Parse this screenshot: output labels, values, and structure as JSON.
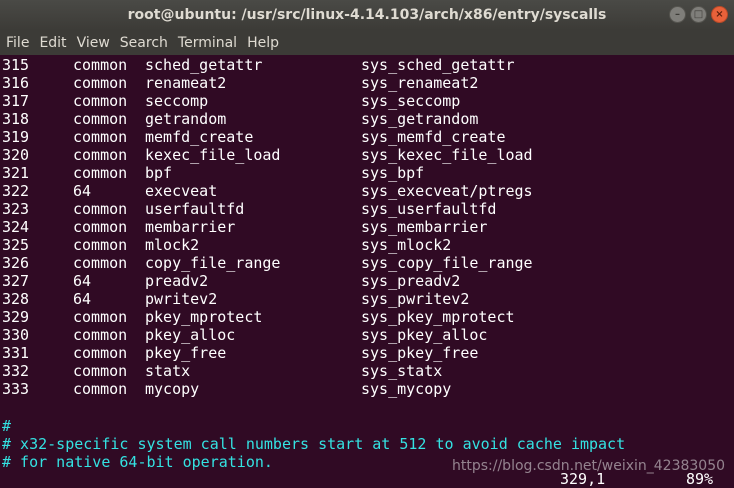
{
  "window": {
    "title": "root@ubuntu: /usr/src/linux-4.14.103/arch/x86/entry/syscalls",
    "minimize": "–",
    "maximize": "□",
    "close": "×"
  },
  "menu": [
    "File",
    "Edit",
    "View",
    "Search",
    "Terminal",
    "Help"
  ],
  "rows": [
    {
      "num": "315",
      "abi": "common",
      "name": "sched_getattr",
      "entry": "sys_sched_getattr"
    },
    {
      "num": "316",
      "abi": "common",
      "name": "renameat2",
      "entry": "sys_renameat2"
    },
    {
      "num": "317",
      "abi": "common",
      "name": "seccomp",
      "entry": "sys_seccomp"
    },
    {
      "num": "318",
      "abi": "common",
      "name": "getrandom",
      "entry": "sys_getrandom"
    },
    {
      "num": "319",
      "abi": "common",
      "name": "memfd_create",
      "entry": "sys_memfd_create"
    },
    {
      "num": "320",
      "abi": "common",
      "name": "kexec_file_load",
      "entry": "sys_kexec_file_load"
    },
    {
      "num": "321",
      "abi": "common",
      "name": "bpf",
      "entry": "sys_bpf"
    },
    {
      "num": "322",
      "abi": "64",
      "name": "execveat",
      "entry": "sys_execveat/ptregs"
    },
    {
      "num": "323",
      "abi": "common",
      "name": "userfaultfd",
      "entry": "sys_userfaultfd"
    },
    {
      "num": "324",
      "abi": "common",
      "name": "membarrier",
      "entry": "sys_membarrier"
    },
    {
      "num": "325",
      "abi": "common",
      "name": "mlock2",
      "entry": "sys_mlock2"
    },
    {
      "num": "326",
      "abi": "common",
      "name": "copy_file_range",
      "entry": "sys_copy_file_range"
    },
    {
      "num": "327",
      "abi": "64",
      "name": "preadv2",
      "entry": "sys_preadv2"
    },
    {
      "num": "328",
      "abi": "64",
      "name": "pwritev2",
      "entry": "sys_pwritev2"
    },
    {
      "num": "329",
      "abi": "common",
      "name": "pkey_mprotect",
      "entry": "sys_pkey_mprotect"
    },
    {
      "num": "330",
      "abi": "common",
      "name": "pkey_alloc",
      "entry": "sys_pkey_alloc"
    },
    {
      "num": "331",
      "abi": "common",
      "name": "pkey_free",
      "entry": "sys_pkey_free"
    },
    {
      "num": "332",
      "abi": "common",
      "name": "statx",
      "entry": "sys_statx"
    },
    {
      "num": "333",
      "abi": "common",
      "name": "mycopy",
      "entry": "sys_mycopy"
    }
  ],
  "comments": [
    "#",
    "# x32-specific system call numbers start at 512 to avoid cache impact",
    "# for native 64-bit operation."
  ],
  "status": {
    "position": "329,1",
    "percent": "89%"
  },
  "watermark": "https://blog.csdn.net/weixin_42383050",
  "colors": {
    "background": "#300a24",
    "comment": "#34e2e2",
    "text": "#ffffff"
  }
}
